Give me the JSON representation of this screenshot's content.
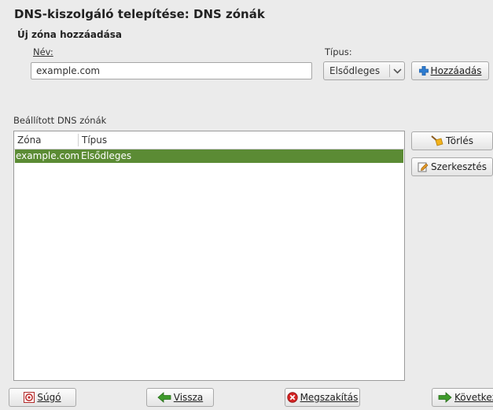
{
  "header": {
    "title": "DNS-kiszolgáló telepítése: DNS zónák"
  },
  "new_zone": {
    "section_title": "Új zóna hozzáadása",
    "name_label": "Név:",
    "name_value": "example.com",
    "type_label": "Típus:",
    "type_selected": "Elsődleges",
    "add_button": "Hozzáadás"
  },
  "configured": {
    "label": "Beállított DNS zónák",
    "columns": [
      "Zóna",
      "Típus"
    ],
    "rows": [
      {
        "zone": "example.com",
        "type": "Elsődleges"
      }
    ],
    "delete_button": "Törlés",
    "edit_button": "Szerkesztés"
  },
  "footer": {
    "help_button": "Súgó",
    "back_button": "Vissza",
    "abort_button": "Megszakítás",
    "next_button": "Következő"
  },
  "colors": {
    "selection": "#5b8b34",
    "add_icon": "#2f7dd1",
    "abort_icon": "#d42424",
    "arrow_icon": "#3e9a2b"
  },
  "icons": {
    "add": "plus-icon",
    "delete": "broom-icon",
    "edit": "edit-icon",
    "help": "help-icon",
    "back": "arrow-left-icon",
    "abort": "cancel-icon",
    "next": "arrow-right-icon",
    "dropdown": "chevron-down-icon"
  }
}
